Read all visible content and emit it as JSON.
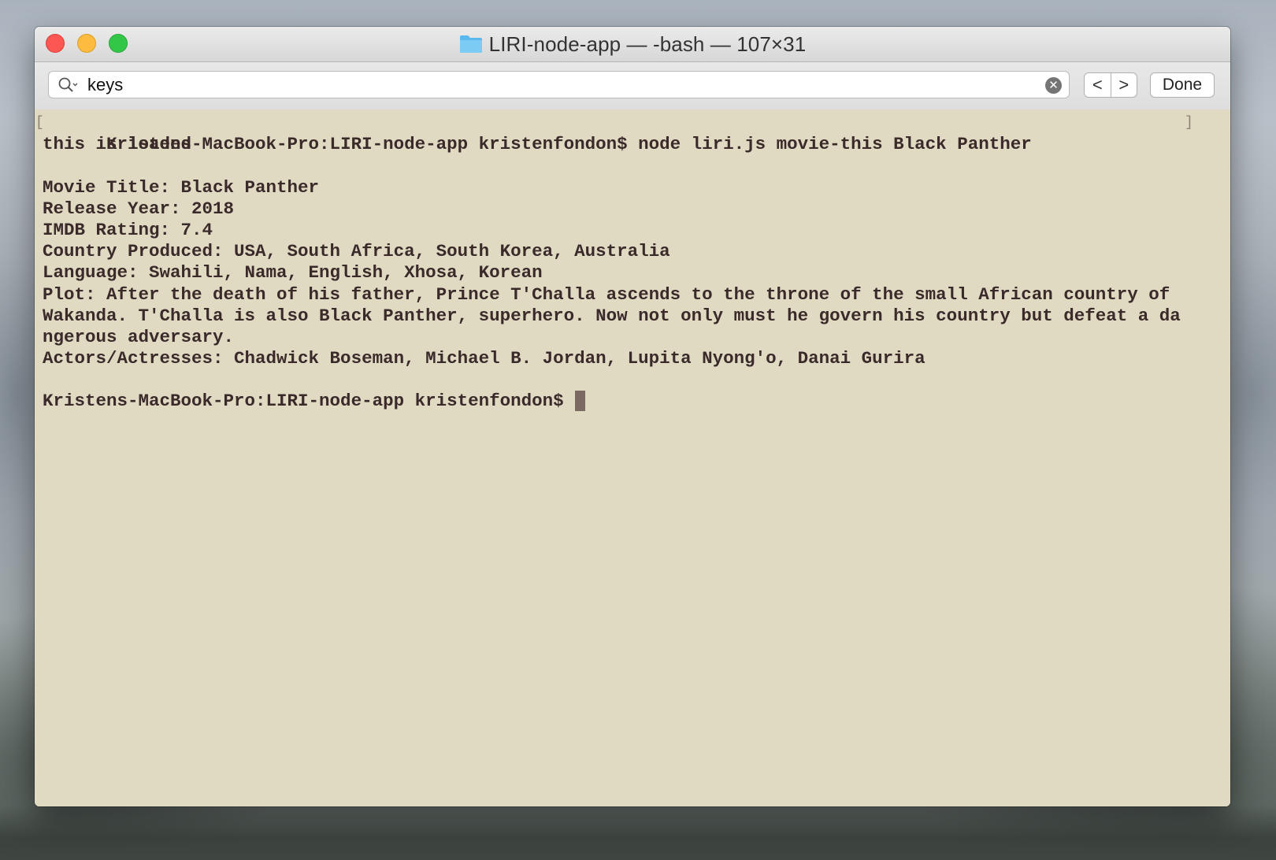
{
  "window": {
    "title": "LIRI-node-app — -bash — 107×31",
    "folder_icon": "folder-icon"
  },
  "findbar": {
    "search_value": "keys",
    "clear_icon": "clear-icon",
    "prev_label": "<",
    "next_label": ">",
    "done_label": "Done"
  },
  "terminal": {
    "lines": [
      "Kristens-MacBook-Pro:LIRI-node-app kristenfondon$ node liri.js movie-this Black Panther",
      "this is loaded",
      "",
      "Movie Title: Black Panther",
      "Release Year: 2018",
      "IMDB Rating: 7.4",
      "Country Produced: USA, South Africa, South Korea, Australia",
      "Language: Swahili, Nama, English, Xhosa, Korean",
      "Plot: After the death of his father, Prince T'Challa ascends to the throne of the small African country of",
      "Wakanda. T'Challa is also Black Panther, superhero. Now not only must he govern his country but defeat a da",
      "ngerous adversary.",
      "Actors/Actresses: Chadwick Boseman, Michael B. Jordan, Lupita Nyong'o, Danai Gurira",
      "",
      "Kristens-MacBook-Pro:LIRI-node-app kristenfondon$"
    ]
  },
  "colors": {
    "terminal_bg": "#e0dac3",
    "terminal_text": "#3a2a2a",
    "cursor": "#7a6a62"
  }
}
